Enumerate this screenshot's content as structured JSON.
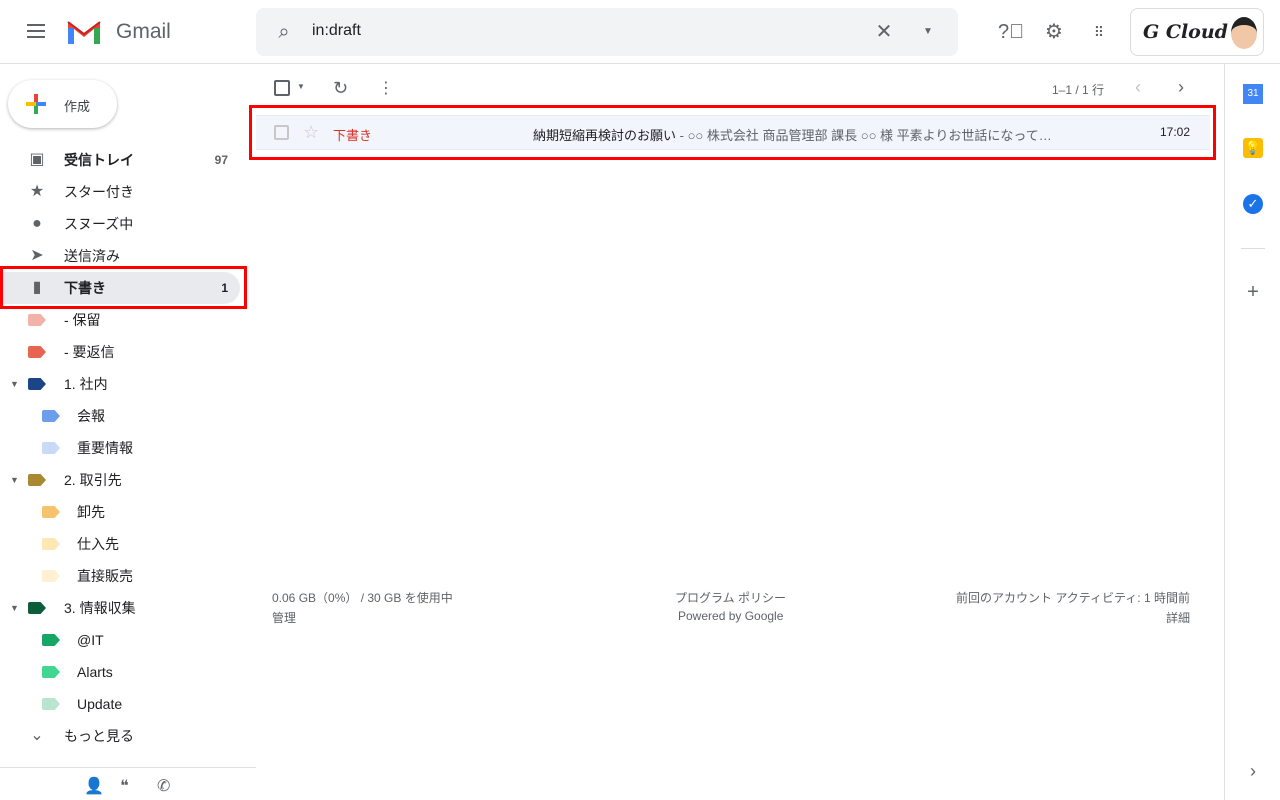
{
  "header": {
    "app_name": "Gmail",
    "search_value": "in:draft",
    "account_brand": "G Cloud"
  },
  "compose": {
    "label": "作成"
  },
  "sidebar": {
    "items": [
      {
        "label": "受信トレイ",
        "count": "97",
        "icon": "inbox-icon"
      },
      {
        "label": "スター付き",
        "icon": "star-icon"
      },
      {
        "label": "スヌーズ中",
        "icon": "clock-icon"
      },
      {
        "label": "送信済み",
        "icon": "send-icon"
      },
      {
        "label": "下書き",
        "count": "1",
        "icon": "draft-icon"
      }
    ],
    "labels": [
      {
        "label": "- 保留",
        "color": "#f2b2a8",
        "level": 0
      },
      {
        "label": "- 要返信",
        "color": "#e66550",
        "level": 0
      },
      {
        "label": "1. 社内",
        "color": "#1c4587",
        "level": 0,
        "expanded": true
      },
      {
        "label": "会報",
        "color": "#6d9eeb",
        "level": 1
      },
      {
        "label": "重要情報",
        "color": "#c9daf8",
        "level": 1
      },
      {
        "label": "2. 取引先",
        "color": "#aa8831",
        "level": 0,
        "expanded": true
      },
      {
        "label": "卸先",
        "color": "#f6c26b",
        "level": 1
      },
      {
        "label": "仕入先",
        "color": "#fce8b3",
        "level": 1
      },
      {
        "label": "直接販売",
        "color": "#fef1d1",
        "level": 1
      },
      {
        "label": "3. 情報収集",
        "color": "#0b5d3b",
        "level": 0,
        "expanded": true
      },
      {
        "label": "@IT",
        "color": "#16a766",
        "level": 1
      },
      {
        "label": "Alarts",
        "color": "#43d692",
        "level": 1
      },
      {
        "label": "Update",
        "color": "#b9e4d0",
        "level": 1
      }
    ],
    "more": "もっと見る"
  },
  "toolbar": {
    "pagination": "1–1 / 1 行"
  },
  "email": {
    "sender": "下書き",
    "subject": "納期短縮再検討のお願い",
    "snippet": " - ○○ 株式会社 商品管理部 課長 ○○ 様 平素よりお世話になって…",
    "time": "17:02"
  },
  "footer": {
    "storage": "0.06 GB（0%） / 30 GB を使用中",
    "manage": "管理",
    "policy": "プログラム ポリシー",
    "powered": "Powered by Google",
    "activity": "前回のアカウント アクティビティ: 1 時間前",
    "details": "詳細"
  },
  "side_panel": {
    "calendar_day": "31"
  },
  "colors": {
    "highlight": "#ff0000",
    "draft_red": "#d93025"
  }
}
